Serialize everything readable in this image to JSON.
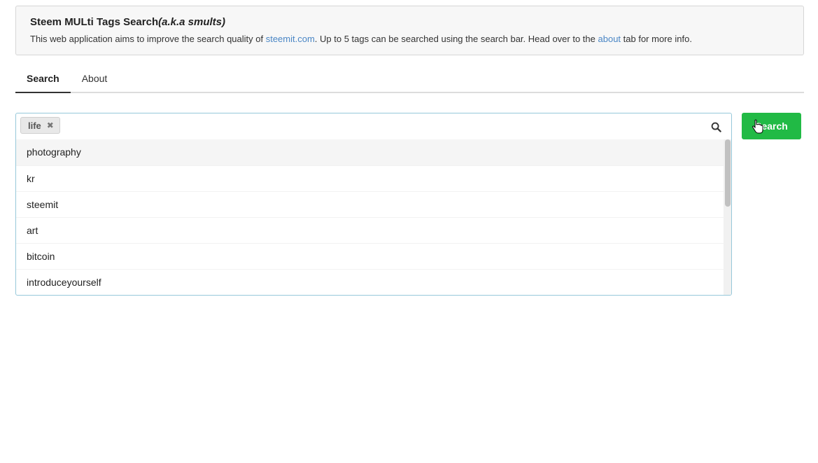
{
  "header": {
    "title": "Steem MULti Tags Search",
    "title_aka": "(a.k.a smults)",
    "desc_part1": "This web application aims to improve the search quality of ",
    "link_steemit": "steemit.com",
    "desc_part2": ". Up to 5 tags can be searched using the search bar. Head over to the ",
    "link_about": "about",
    "desc_part3": " tab for more info."
  },
  "tabs": [
    {
      "label": "Search",
      "active": true
    },
    {
      "label": "About",
      "active": false
    }
  ],
  "search": {
    "tags": [
      {
        "label": "life",
        "remove_icon": "close-icon"
      }
    ],
    "search_icon": "search-icon",
    "suggestions": [
      "photography",
      "kr",
      "steemit",
      "art",
      "bitcoin",
      "introduceyourself"
    ],
    "button_label": "Search"
  },
  "colors": {
    "accent_green": "#21ba45",
    "link_blue": "#4a86c5",
    "input_border": "#96c8da"
  }
}
